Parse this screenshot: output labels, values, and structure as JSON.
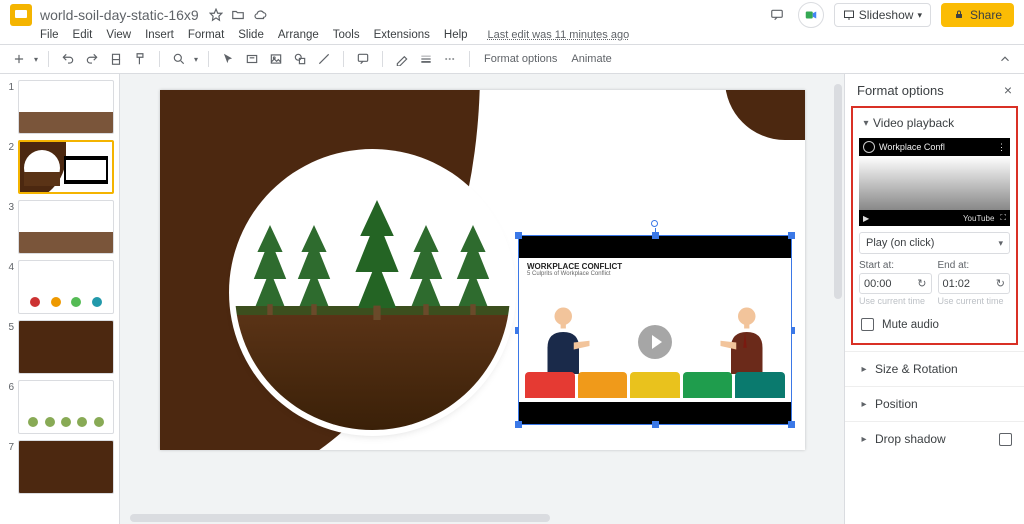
{
  "titlebar": {
    "doc_title": "world-soil-day-static-16x9",
    "slideshow_label": "Slideshow",
    "share_label": "Share"
  },
  "menu": {
    "items": [
      "File",
      "Edit",
      "View",
      "Insert",
      "Format",
      "Slide",
      "Arrange",
      "Tools",
      "Extensions",
      "Help"
    ],
    "last_edit": "Last edit was 11 minutes ago"
  },
  "toolbar": {
    "format_options": "Format options",
    "animate": "Animate"
  },
  "thumbnails": {
    "numbers": [
      "1",
      "2",
      "3",
      "4",
      "5",
      "6",
      "7"
    ],
    "active_index": 1
  },
  "slide_video": {
    "title": "WORKPLACE CONFLICT",
    "subtitle": "5 Culprits of Workplace Conflict"
  },
  "panel": {
    "title": "Format options",
    "sections": {
      "video_playback": "Video playback",
      "size_rotation": "Size & Rotation",
      "position": "Position",
      "drop_shadow": "Drop shadow"
    },
    "preview_title": "Workplace Confl",
    "preview_brand": "YouTube",
    "play_mode": "Play (on click)",
    "start_label": "Start at:",
    "end_label": "End at:",
    "start_value": "00:00",
    "end_value": "01:02",
    "use_current": "Use current time",
    "mute_label": "Mute audio"
  }
}
